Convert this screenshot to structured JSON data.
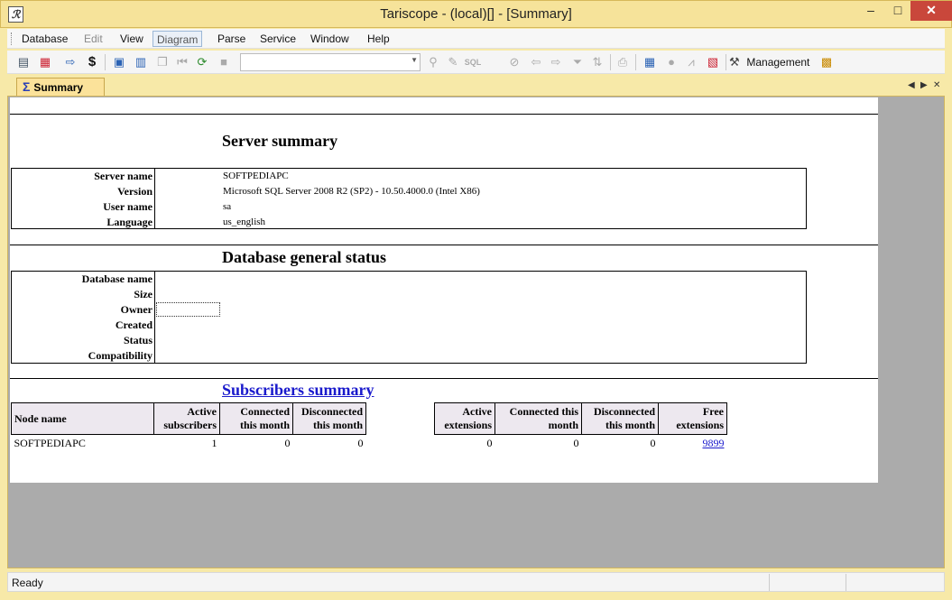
{
  "window": {
    "title": "Tariscope - (local)[] - [Summary]",
    "app_icon": "app-logo-icon",
    "minimize_glyph": "‒",
    "maximize_glyph": "□",
    "close_glyph": "✕"
  },
  "menu": {
    "items": [
      "Database",
      "Edit",
      "View",
      "Diagram",
      "Parse",
      "Service",
      "Window",
      "Help"
    ]
  },
  "toolbar": {
    "management_label": "Management",
    "icons": [
      "connect-icon",
      "disconnect-icon",
      "export-icon",
      "tariff-icon",
      "new-folder-icon",
      "table-icon",
      "copy-icon",
      "first-icon",
      "refresh-icon",
      "stop-icon",
      "filter-icon",
      "filter-edit-icon",
      "sql-icon",
      "filter-clear-icon",
      "back-icon",
      "forward-icon",
      "funnel-icon",
      "sort-icon",
      "print-icon",
      "grid-icon",
      "chart-dot-icon",
      "line-chart-icon",
      "report-icon",
      "management-icon",
      "lock-icon"
    ]
  },
  "tab": {
    "label": "Summary"
  },
  "server_summary": {
    "heading": "Server summary",
    "rows": [
      {
        "label": "Server name",
        "value": "SOFTPEDIAPC"
      },
      {
        "label": "Version",
        "value": "Microsoft SQL Server 2008 R2 (SP2) - 10.50.4000.0 (Intel X86)"
      },
      {
        "label": "User name",
        "value": "sa"
      },
      {
        "label": "Language",
        "value": "us_english"
      }
    ]
  },
  "database_status": {
    "heading": "Database general status",
    "rows": [
      {
        "label": "Database name",
        "value": ""
      },
      {
        "label": "Size",
        "value": ""
      },
      {
        "label": "Owner",
        "value": ""
      },
      {
        "label": "Created",
        "value": ""
      },
      {
        "label": "Status",
        "value": ""
      },
      {
        "label": "Compatibility",
        "value": ""
      }
    ]
  },
  "subscribers": {
    "heading": "Subscribers summary",
    "left_headers": [
      "Node name",
      "Active subscribers",
      "Connected this month",
      "Disconnected this month"
    ],
    "right_headers": [
      "Active extensions",
      "Connected this month",
      "Disconnected this month",
      "Free extensions"
    ],
    "left_row": [
      "SOFTPEDIAPC",
      "1",
      "0",
      "0"
    ],
    "right_row": [
      "0",
      "0",
      "0",
      "9899"
    ]
  },
  "status": {
    "text": "Ready"
  }
}
